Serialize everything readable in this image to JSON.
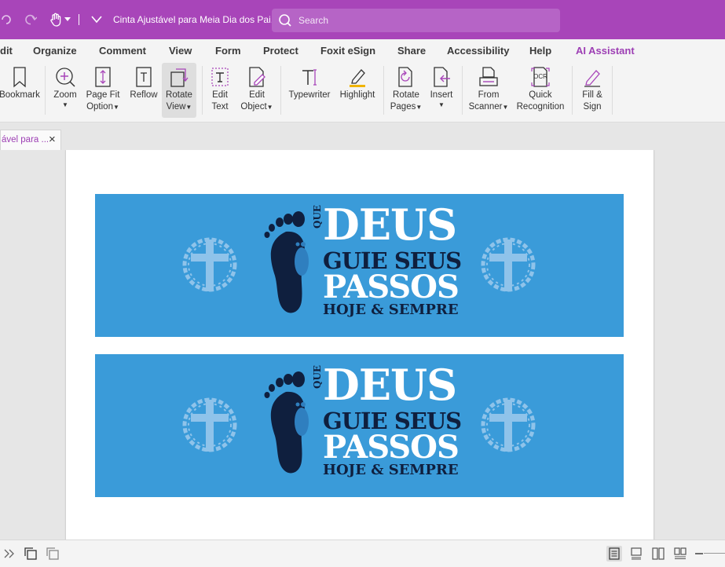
{
  "app": {
    "doc_title": "Cinta Ajustável para Meia Dia dos Pai...",
    "search_placeholder": "Search"
  },
  "menu": [
    "dit",
    "Organize",
    "Comment",
    "View",
    "Form",
    "Protect",
    "Foxit eSign",
    "Share",
    "Accessibility",
    "Help",
    "AI Assistant"
  ],
  "ribbon": {
    "bookmark": "Bookmark",
    "zoom": "Zoom",
    "page_fit_1": "Page Fit",
    "page_fit_2": "Option",
    "reflow": "Reflow",
    "rotate_view_1": "Rotate",
    "rotate_view_2": "View",
    "edit_text_1": "Edit",
    "edit_text_2": "Text",
    "edit_object_1": "Edit",
    "edit_object_2": "Object",
    "typewriter": "Typewriter",
    "highlight": "Highlight",
    "rotate_pages_1": "Rotate",
    "rotate_pages_2": "Pages",
    "insert": "Insert",
    "from_scanner_1": "From",
    "from_scanner_2": "Scanner",
    "quick_recognition_1": "Quick",
    "quick_recognition_2": "Recognition",
    "ocr_badge": "OCR",
    "fill_sign_1": "Fill &",
    "fill_sign_2": "Sign"
  },
  "tab": {
    "label": "ável para ...",
    "close": "×"
  },
  "document": {
    "banner_text": {
      "que": "QUE",
      "deus": "DEUS",
      "guie": "GUIE SEUS",
      "passos": "PASSOS",
      "hoje": "HOJE & SEMPRE"
    }
  },
  "colors": {
    "accent": "#a845b9",
    "banner_blue": "#3a9bd9",
    "navy": "#0f1f3e",
    "cross_light": "#8fc3ea"
  }
}
